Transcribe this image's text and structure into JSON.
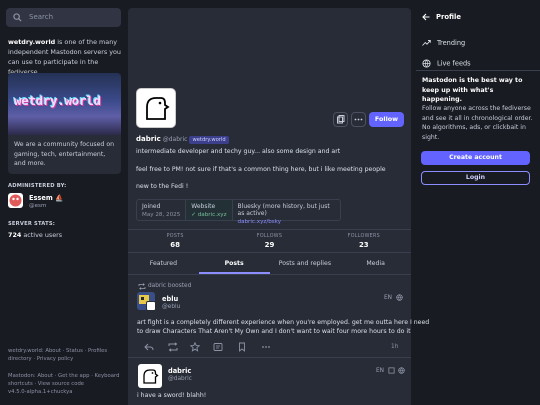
{
  "search": {
    "placeholder": "Search"
  },
  "server": {
    "name": "wetdry.world",
    "intro_rest": " is one of the many independent Mastodon servers you can use to participate in the fediverse.",
    "hero_text": "wetdry.world",
    "description": "We are a community focused on gaming, tech, entertainment, and more."
  },
  "admin": {
    "label": "ADMINISTERED BY:",
    "name": "Essem ⛵",
    "handle": "@esm"
  },
  "stats_server": {
    "label": "SERVER STATS:",
    "active": "724",
    "active_label": " active users"
  },
  "footer": {
    "line1": "wetdry.world: About · Status · Profiles directory · Privacy policy",
    "line2": "Mastodon: About · Get the app · Keyboard shortcuts · View source code",
    "version": "v4.5.0-alpha.1+chuckya"
  },
  "profile": {
    "display_name": "dabric",
    "handle": "@dabric",
    "badge": "wetdry.world",
    "follow_label": "Follow",
    "bio_line1": "intermediate developer and techy guy... also some design and art",
    "bio_line2": "feel free to PM! not sure if that's a common thing here, but i like meeting people",
    "bio_line3": "new to the Fedi !",
    "fields": [
      {
        "key": "Joined",
        "value": "May 28, 2025"
      },
      {
        "key": "Website",
        "value": "✓ dabric.xyz"
      },
      {
        "key": "Bluesky (more history, but just as active)",
        "value": "dabric.xyz/bsky"
      }
    ],
    "counts": [
      {
        "label": "POSTS",
        "value": "68"
      },
      {
        "label": "FOLLOWS",
        "value": "29"
      },
      {
        "label": "FOLLOWERS",
        "value": "23"
      }
    ]
  },
  "tabs": [
    "Featured",
    "Posts",
    "Posts and replies",
    "Media"
  ],
  "statuses": [
    {
      "boost_label": "dabric boosted",
      "name": "eblu",
      "handle": "@eblu",
      "lang": "EN",
      "line1": "art fight is a completely different experience when you're employed. get me outta here I need",
      "line2": "to draw Characters That Aren't My Own and I don't want to wait four more hours to do it",
      "time": "1h"
    },
    {
      "name": "dabric",
      "handle": "@dabric",
      "lang": "EN",
      "line1": "i have a sword! blahh!"
    }
  ],
  "right": {
    "header": "Profile",
    "items": [
      "Trending",
      "Live feeds"
    ],
    "tagline": "Mastodon is the best way to keep up with what's happening.",
    "description": "Follow anyone across the fediverse and see it all in chronological order. No algorithms, ads, or clickbait in sight.",
    "create_label": "Create account",
    "login_label": "Login"
  },
  "colors": {
    "accent": "#6364ff",
    "background": "#191b22",
    "panel": "#282c37",
    "verified": "#79bd9a"
  }
}
